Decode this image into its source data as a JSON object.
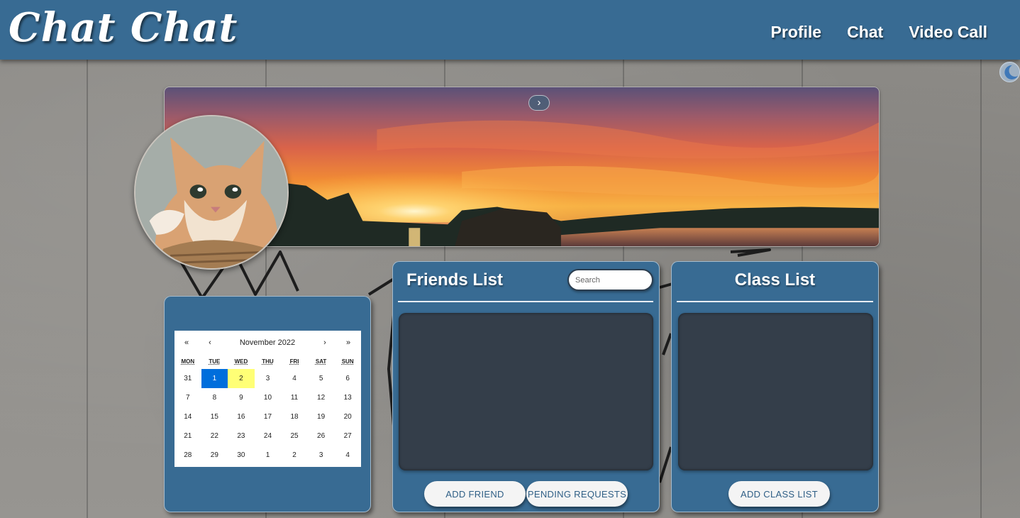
{
  "navbar": {
    "brand": "Chat Chat",
    "links": [
      "Profile",
      "Chat",
      "Video Call"
    ]
  },
  "theme_toggle": {
    "icon": "moon-icon"
  },
  "banner": {
    "image": "sunset-lake-banner",
    "next_icon": "›"
  },
  "avatar": {
    "image": "cat-profile-photo"
  },
  "calendar": {
    "prev_year": "«",
    "prev_month": "‹",
    "label": "November 2022",
    "next_month": "›",
    "next_year": "»",
    "weekdays": [
      "MON",
      "TUE",
      "WED",
      "THU",
      "FRI",
      "SAT",
      "SUN"
    ],
    "days": [
      "31",
      "1",
      "2",
      "3",
      "4",
      "5",
      "6",
      "7",
      "8",
      "9",
      "10",
      "11",
      "12",
      "13",
      "14",
      "15",
      "16",
      "17",
      "18",
      "19",
      "20",
      "21",
      "22",
      "23",
      "24",
      "25",
      "26",
      "27",
      "28",
      "29",
      "30",
      "1",
      "2",
      "3",
      "4"
    ],
    "selected_index": 1,
    "today_index": 2,
    "selected_color": "#006edc",
    "today_color": "#ffff76"
  },
  "friends": {
    "title": "Friends List",
    "search_placeholder": "Search",
    "add_button": "ADD FRIEND",
    "pending_button": "PENDING REQUESTS"
  },
  "classes": {
    "title": "Class List",
    "add_button": "ADD CLASS LIST"
  },
  "colors": {
    "navbar": "#386b93",
    "panel": "#386b93",
    "list_bg": "#343e4a",
    "button_text": "#2f5f86"
  }
}
